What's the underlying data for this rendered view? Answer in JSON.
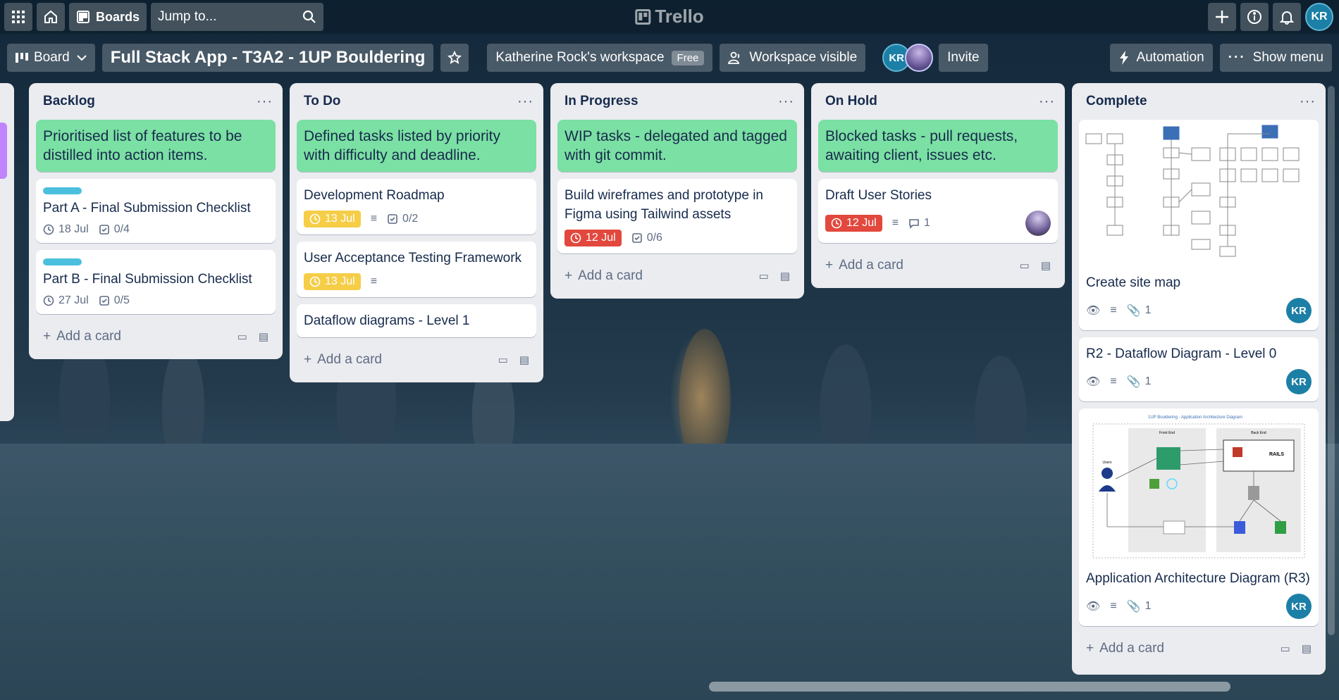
{
  "topbar": {
    "boards_label": "Boards",
    "jump_placeholder": "Jump to...",
    "logo_text": "Trello",
    "user_initials": "KR"
  },
  "board": {
    "view_label": "Board",
    "title": "Full Stack App - T3A2 - 1UP Bouldering",
    "workspace_label": "Katherine Rock's workspace",
    "workspace_plan": "Free",
    "visibility_label": "Workspace visible",
    "member_initials": "KR",
    "invite_label": "Invite",
    "automation_label": "Automation",
    "show_menu_label": "Show menu"
  },
  "add_card_label": "Add a card",
  "lists": [
    {
      "title": "Backlog",
      "header_card": "Prioritised list of features to be distilled into action items.",
      "cards": [
        {
          "title": "Part A - Final Submission Checklist",
          "due": "18 Jul",
          "checklist": "0/4"
        },
        {
          "title": "Part B - Final Submission Checklist",
          "due": "27 Jul",
          "checklist": "0/5"
        }
      ]
    },
    {
      "title": "To Do",
      "header_card": "Defined tasks listed by priority with difficulty and deadline.",
      "cards": [
        {
          "title": "Development Roadmap",
          "due": "13 Jul",
          "checklist": "0/2"
        },
        {
          "title": "User Acceptance Testing Framework",
          "due": "13 Jul"
        },
        {
          "title": "Dataflow diagrams - Level 1"
        }
      ]
    },
    {
      "title": "In Progress",
      "header_card": "WIP tasks - delegated and tagged with git commit.",
      "cards": [
        {
          "title": "Build wireframes and prototype in Figma using Tailwind assets",
          "due": "12 Jul",
          "checklist": "0/6"
        }
      ]
    },
    {
      "title": "On Hold",
      "header_card": "Blocked tasks - pull requests, awaiting client, issues etc.",
      "cards": [
        {
          "title": "Draft User Stories",
          "due": "12 Jul",
          "comments": "1"
        }
      ]
    },
    {
      "title": "Complete",
      "cards": [
        {
          "title": "Create site map",
          "attachments": "1",
          "member": "KR"
        },
        {
          "title": "R2 - Dataflow Diagram - Level 0",
          "attachments": "1",
          "member": "KR"
        },
        {
          "title": "Application Architecture Diagram (R3)",
          "attachments": "1",
          "member": "KR",
          "cover": {
            "heading": "1UP Bouldering - Application Architecture Diagram",
            "front_end": "Front End",
            "back_end": "Back End",
            "users": "Users"
          }
        }
      ]
    }
  ],
  "colors": {
    "header_card": "#7be0a3",
    "label_blue": "#4bc0de",
    "due_yellow": "#f5cd47",
    "due_red": "#e2483d"
  }
}
